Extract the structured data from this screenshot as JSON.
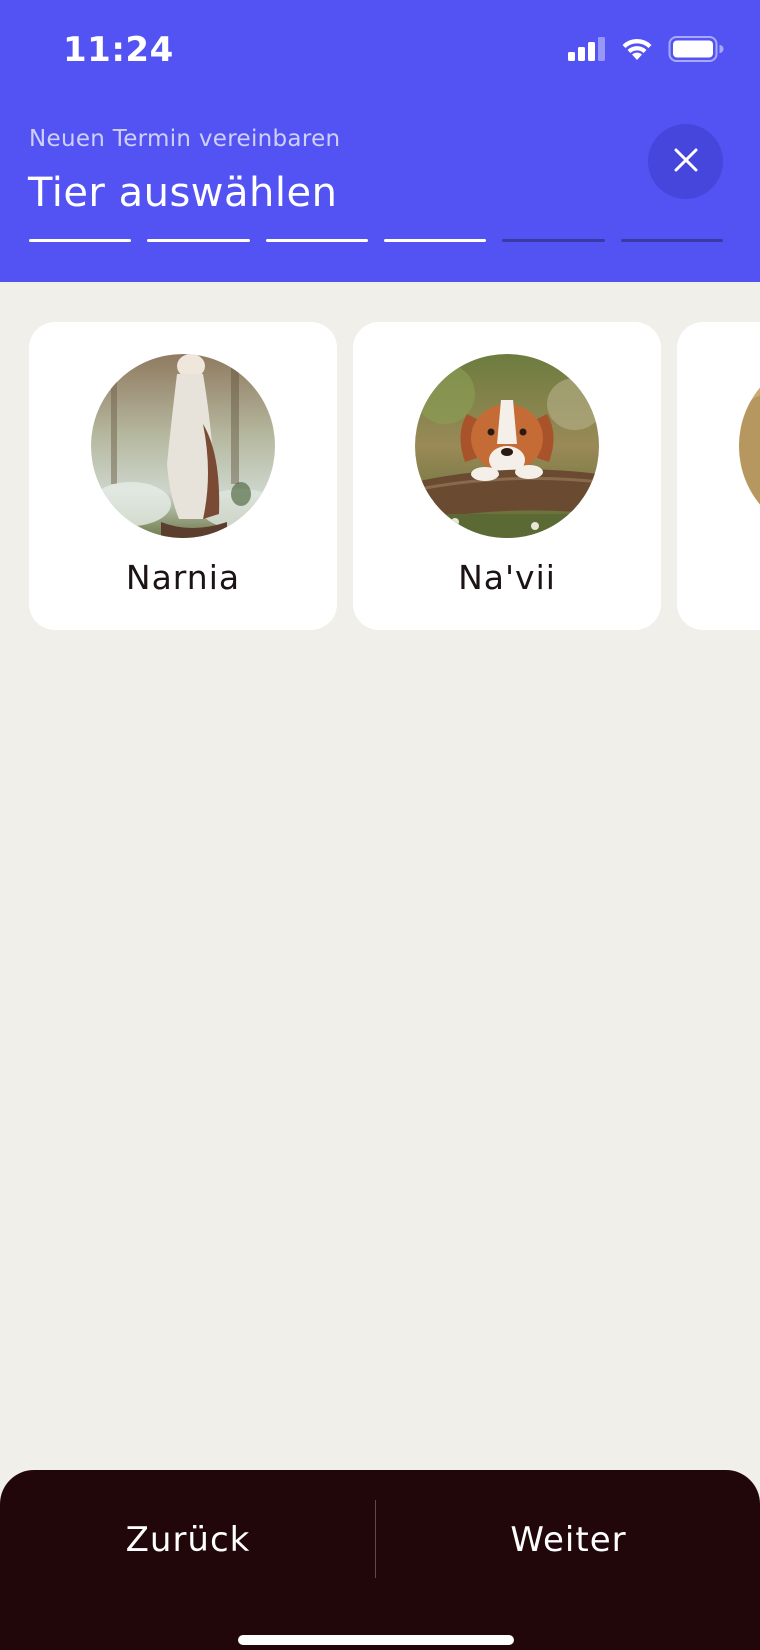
{
  "status_bar": {
    "time": "11:24",
    "icons": [
      "cellular-signal-icon",
      "wifi-icon",
      "battery-icon"
    ]
  },
  "header": {
    "subtitle": "Neuen Termin vereinbaren",
    "title": "Tier auswählen",
    "close_icon": "close-icon",
    "progress": {
      "total_steps": 6,
      "completed_steps": 4
    }
  },
  "pets": [
    {
      "name": "Narnia"
    },
    {
      "name": "Na'vii"
    }
  ],
  "footer": {
    "back_label": "Zurück",
    "next_label": "Weiter"
  },
  "colors": {
    "header_bg": "#5353f3",
    "page_bg": "#f0efe9",
    "card_bg": "#ffffff",
    "footer_bg": "#21060a"
  }
}
